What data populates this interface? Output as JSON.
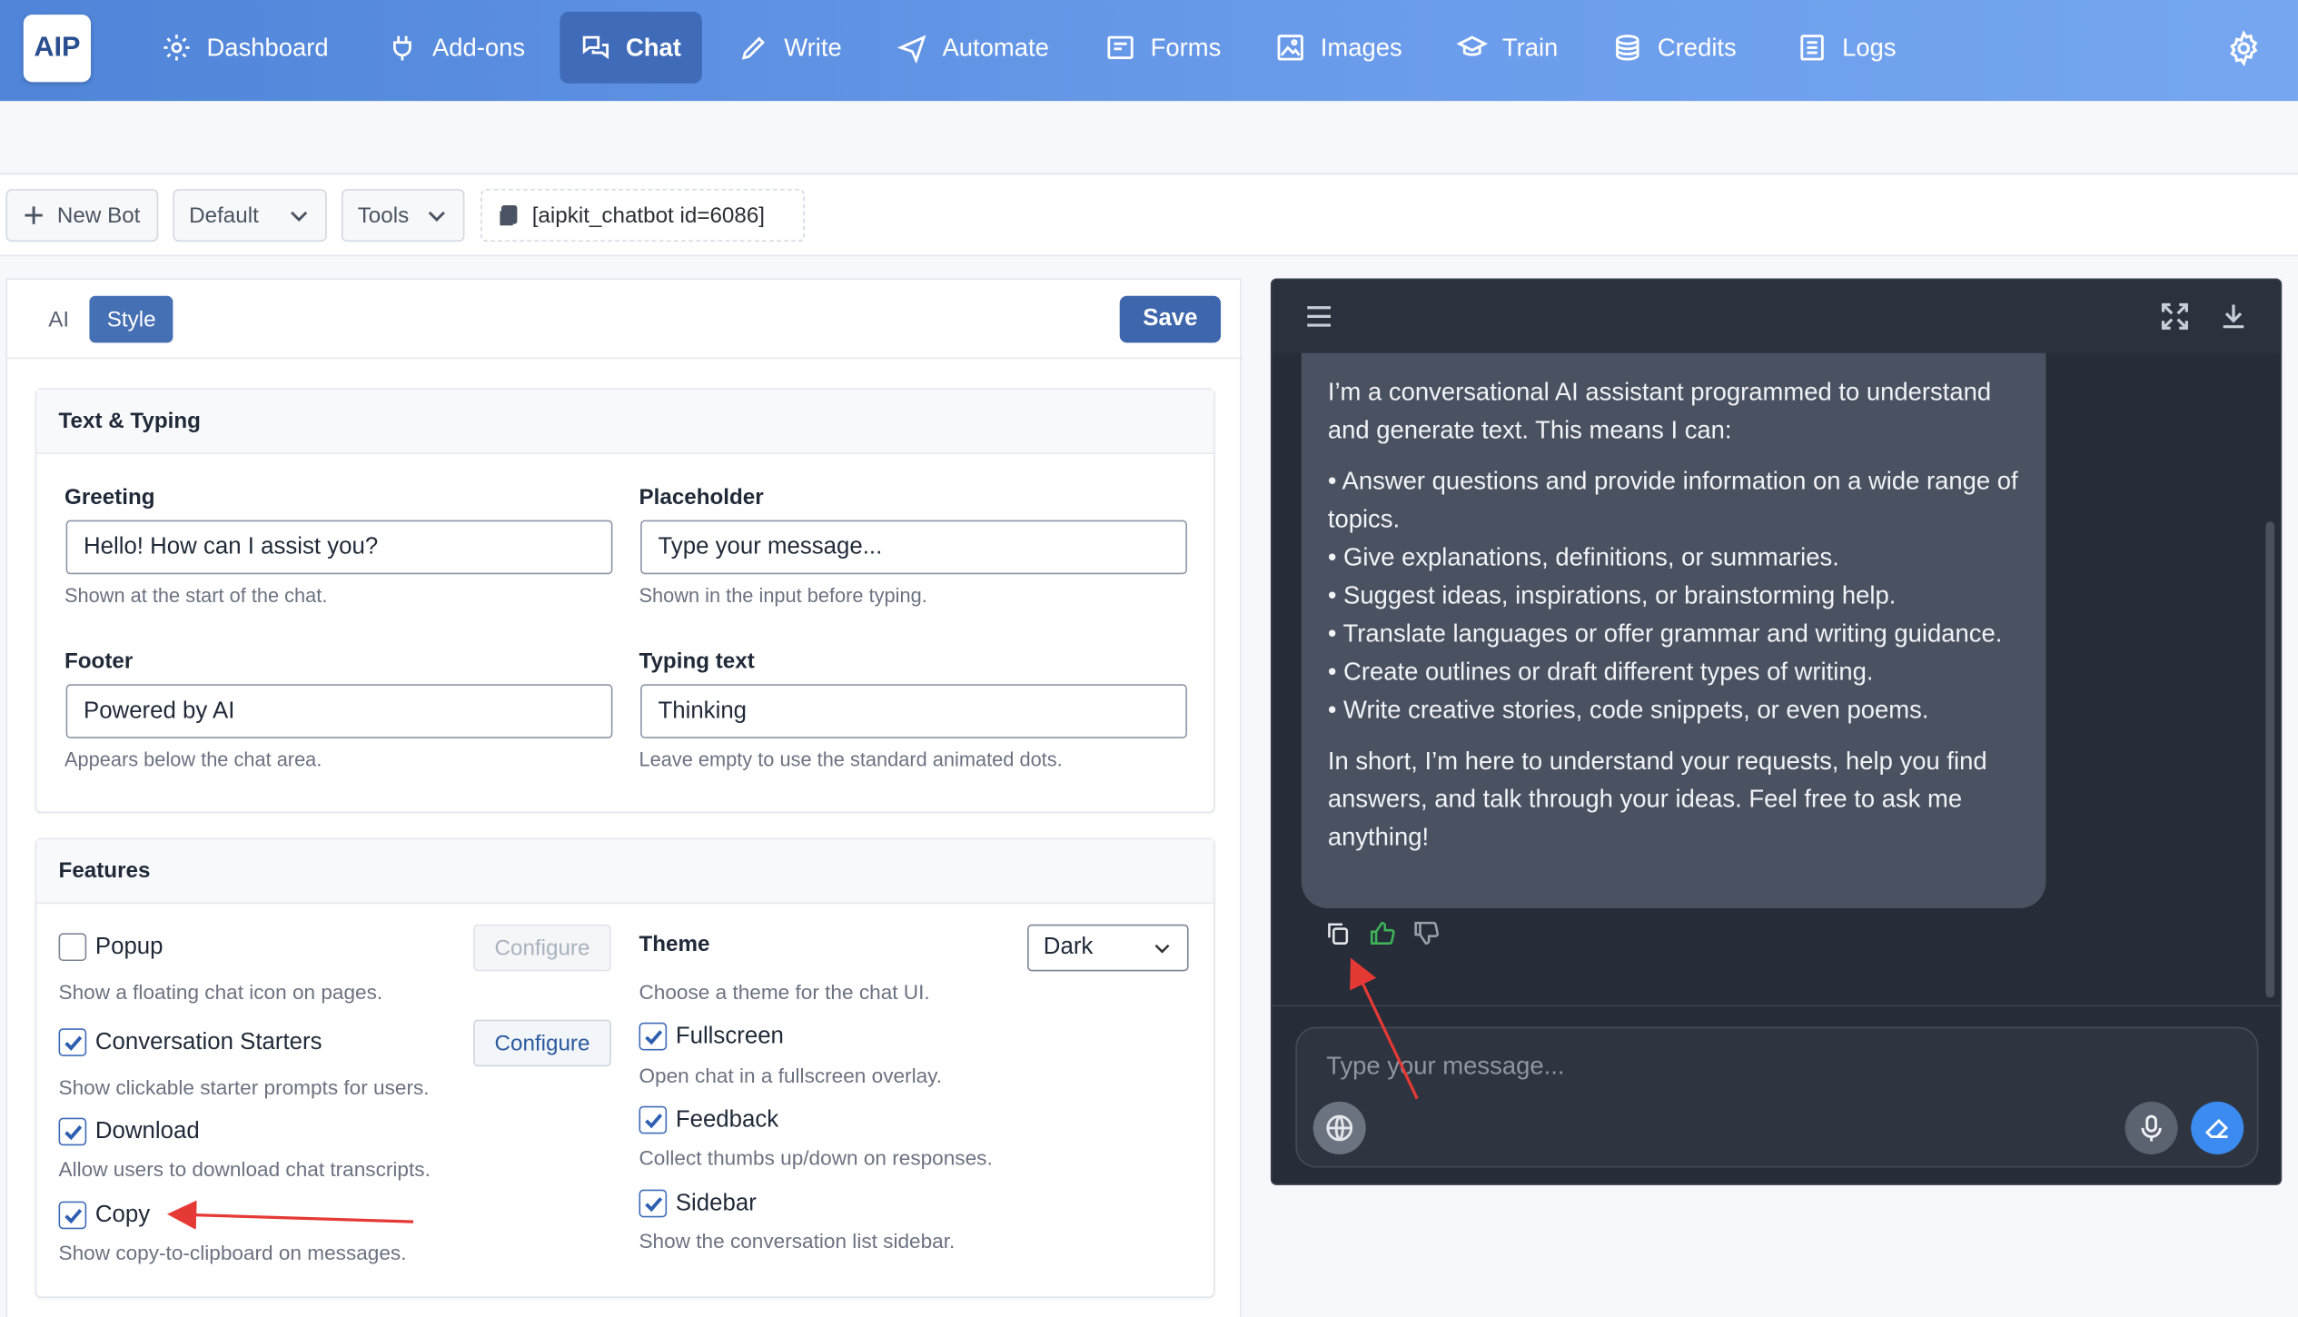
{
  "app": {
    "logo": "AIP"
  },
  "nav": [
    {
      "label": "Dashboard",
      "icon": "gear-icon"
    },
    {
      "label": "Add-ons",
      "icon": "plug-icon"
    },
    {
      "label": "Chat",
      "icon": "chat-icon",
      "active": true
    },
    {
      "label": "Write",
      "icon": "pencil-icon"
    },
    {
      "label": "Automate",
      "icon": "plane-icon"
    },
    {
      "label": "Forms",
      "icon": "form-icon"
    },
    {
      "label": "Images",
      "icon": "image-icon"
    },
    {
      "label": "Train",
      "icon": "graduation-icon"
    },
    {
      "label": "Credits",
      "icon": "coins-icon"
    },
    {
      "label": "Logs",
      "icon": "list-icon"
    }
  ],
  "toolbar": {
    "new_bot": "New Bot",
    "default": "Default",
    "tools": "Tools",
    "shortcode": "[aipkit_chatbot id=6086]"
  },
  "panel": {
    "tab_ai": "AI",
    "tab_style": "Style",
    "save": "Save"
  },
  "text_typing": {
    "title": "Text & Typing",
    "greeting": {
      "label": "Greeting",
      "value": "Hello! How can I assist you?",
      "help": "Shown at the start of the chat."
    },
    "placeholder": {
      "label": "Placeholder",
      "value": "Type your message...",
      "help": "Shown in the input before typing."
    },
    "footer": {
      "label": "Footer",
      "value": "Powered by AI",
      "help": "Appears below the chat area."
    },
    "typing": {
      "label": "Typing text",
      "value": "Thinking",
      "help": "Leave empty to use the standard animated dots."
    }
  },
  "features": {
    "title": "Features",
    "popup": {
      "label": "Popup",
      "help": "Show a floating chat icon on pages.",
      "checked": false,
      "configure": "Configure"
    },
    "starters": {
      "label": "Conversation Starters",
      "help": "Show clickable starter prompts for users.",
      "checked": true,
      "configure": "Configure"
    },
    "download": {
      "label": "Download",
      "help": "Allow users to download chat transcripts.",
      "checked": true
    },
    "copy": {
      "label": "Copy",
      "help": "Show copy-to-clipboard on messages.",
      "checked": true
    },
    "theme": {
      "label": "Theme",
      "help": "Choose a theme for the chat UI.",
      "value": "Dark"
    },
    "fullscreen": {
      "label": "Fullscreen",
      "help": "Open chat in a fullscreen overlay.",
      "checked": true
    },
    "feedback": {
      "label": "Feedback",
      "help": "Collect thumbs up/down on responses.",
      "checked": true
    },
    "sidebar": {
      "label": "Sidebar",
      "help": "Show the conversation list sidebar.",
      "checked": true
    }
  },
  "chat": {
    "intro": "I’m a conversational AI assistant programmed to understand and generate text. This means I can:",
    "bullets": [
      "• Answer questions and provide information on a wide range of topics.",
      "• Give explanations, definitions, or summaries.",
      "• Suggest ideas, inspirations, or brainstorming help.",
      "• Translate languages or offer grammar and writing guidance.",
      "• Create outlines or draft different types of writing.",
      "• Write creative stories, code snippets, or even poems."
    ],
    "outro": "In short, I’m here to understand your requests, help you find answers, and talk through your ideas. Feel free to ask me anything!",
    "input_placeholder": "Type your message..."
  },
  "colors": {
    "nav": "#5b8ee0",
    "accent": "#3d66ad",
    "chat_bg": "#262d38",
    "bubble": "#4a5261",
    "send": "#3b8bf0",
    "annotation": "#e53935"
  }
}
